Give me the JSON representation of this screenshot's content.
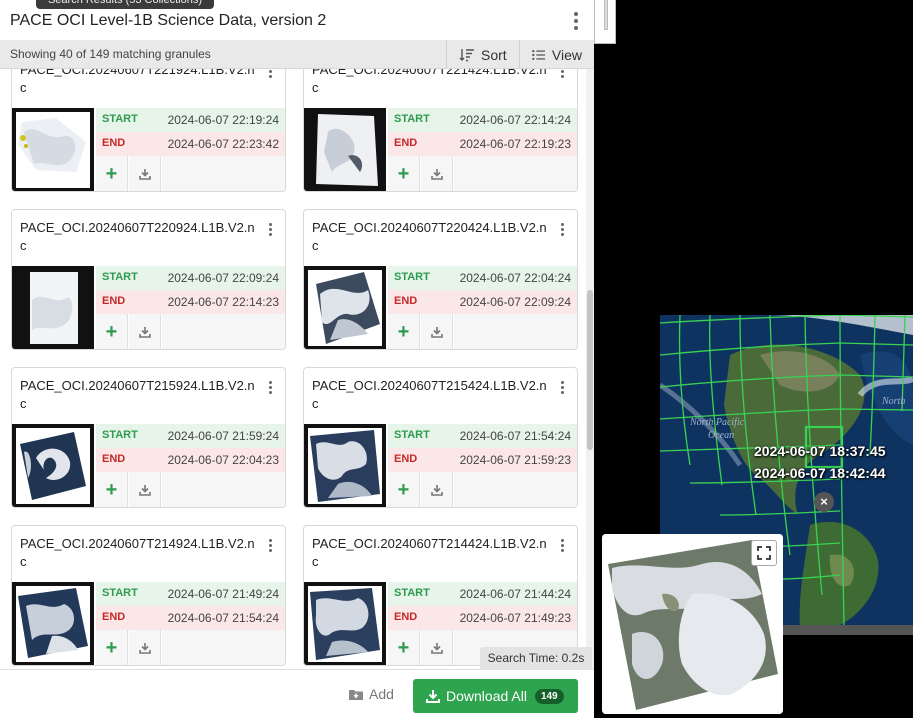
{
  "header": {
    "tooltip": "Search Results (53 Collections)",
    "title": "PACE OCI Level-1B Science Data, version 2"
  },
  "toolbar": {
    "count_text": "Showing 40 of 149 matching granules",
    "sort_label": "Sort",
    "view_label": "View"
  },
  "labels": {
    "start": "START",
    "end": "END"
  },
  "granules": [
    {
      "name": "PACE_OCI.20240607T221924.L1B.V2.nc",
      "start": "2024-06-07 22:19:24",
      "end": "2024-06-07 22:23:42"
    },
    {
      "name": "PACE_OCI.20240607T221424.L1B.V2.nc",
      "start": "2024-06-07 22:14:24",
      "end": "2024-06-07 22:19:23"
    },
    {
      "name": "PACE_OCI.20240607T220924.L1B.V2.nc",
      "start": "2024-06-07 22:09:24",
      "end": "2024-06-07 22:14:23"
    },
    {
      "name": "PACE_OCI.20240607T220424.L1B.V2.nc",
      "start": "2024-06-07 22:04:24",
      "end": "2024-06-07 22:09:24"
    },
    {
      "name": "PACE_OCI.20240607T215924.L1B.V2.nc",
      "start": "2024-06-07 21:59:24",
      "end": "2024-06-07 22:04:23"
    },
    {
      "name": "PACE_OCI.20240607T215424.L1B.V2.nc",
      "start": "2024-06-07 21:54:24",
      "end": "2024-06-07 21:59:23"
    },
    {
      "name": "PACE_OCI.20240607T214924.L1B.V2.nc",
      "start": "2024-06-07 21:49:24",
      "end": "2024-06-07 21:54:24"
    },
    {
      "name": "PACE_OCI.20240607T214424.L1B.V2.nc",
      "start": "2024-06-07 21:44:24",
      "end": "2024-06-07 21:49:23"
    }
  ],
  "search_time": "Search Time: 0.2s",
  "footer": {
    "add_label": "Add",
    "download_label": "Download All",
    "download_count": "149"
  },
  "map": {
    "labels": [
      "North Pacific",
      "Ocean",
      "North"
    ],
    "hover_start": "2024-06-07 18:37:45",
    "hover_end": "2024-06-07 18:42:44",
    "close_glyph": "×"
  },
  "colors": {
    "start_green": "#2e9b4e",
    "end_red": "#c62828",
    "download_green": "#2ea44f",
    "footprint_green": "#39d353"
  }
}
